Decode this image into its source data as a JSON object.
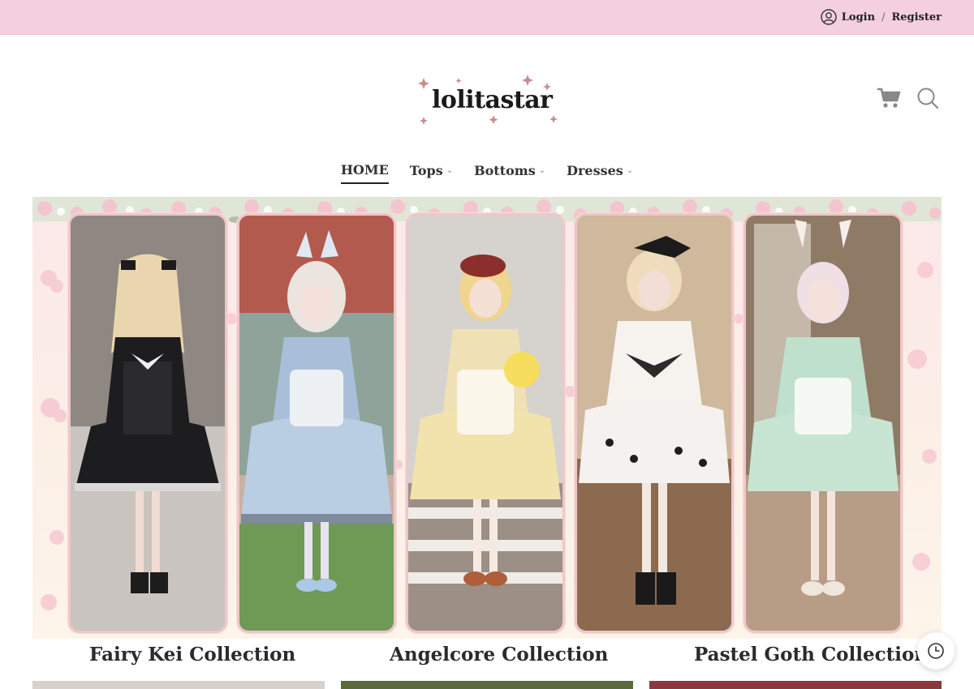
{
  "account": {
    "login_label": "Login",
    "separator": "/",
    "register_label": "Register"
  },
  "logo": {
    "text": "lolitastar"
  },
  "nav": {
    "items": [
      {
        "label": "HOME",
        "active": true,
        "has_dropdown": false
      },
      {
        "label": "Tops",
        "active": false,
        "has_dropdown": true
      },
      {
        "label": "Bottoms",
        "active": false,
        "has_dropdown": true
      },
      {
        "label": "Dresses",
        "active": false,
        "has_dropdown": true
      }
    ]
  },
  "header_icons": [
    "cart-icon",
    "search-icon"
  ],
  "collections": [
    {
      "title": "Fairy Kei Collection"
    },
    {
      "title": "Angelcore Collection"
    },
    {
      "title": "Pastel Goth Collection"
    }
  ],
  "colors": {
    "topbar": "#f4cfdd",
    "panel_border": "#efc7c9",
    "text": "#2b2b2b"
  }
}
